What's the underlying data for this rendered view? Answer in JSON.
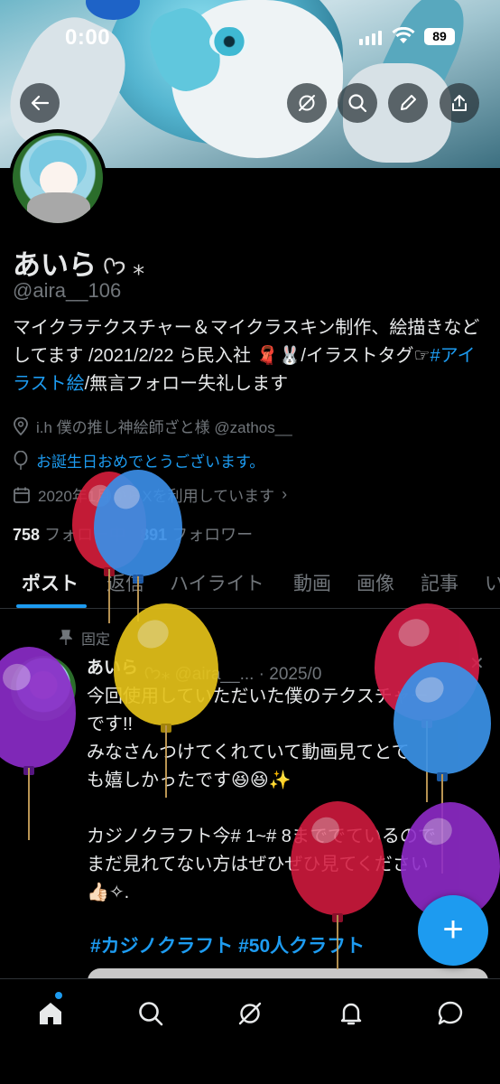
{
  "status_bar": {
    "time": "0:00",
    "battery": "89"
  },
  "profile": {
    "display_name": "あいら",
    "name_emoji": "ᢉ𐭩 ⁎",
    "handle": "@aira__106",
    "bio_part1": "マイクラテクスチャー＆マイクラスキン制作、絵描きなどしてます /2021/2/22 ら民入社 🧣🐰/イラストタグ☞",
    "bio_tag": "#アイラスト絵",
    "bio_part2": "/無言フォロー失礼します",
    "location": "i.h 僕の推し神絵師ざと様 @zathos__",
    "birthday": "お誕生日おめでとうございます。",
    "joined": "2020年1月からXを利用しています",
    "following_count": "758",
    "following_label": "フォロー中",
    "followers_count": "891",
    "followers_label": "フォロワー"
  },
  "tabs": [
    "ポスト",
    "返信",
    "ハイライト",
    "動画",
    "画像",
    "記事",
    "いいね"
  ],
  "post": {
    "pinned_label": "固定",
    "author": "あいら",
    "meta": "ᢉ𐭩⁎ @aira__... · 2025/0",
    "line1": "今回使用していただいた僕のテクスチャー",
    "line2": "です!!",
    "line3": "みなさんつけてくれていて動画見てとて",
    "line4": "も嬉しかったです😆😆✨",
    "line5": "",
    "line6": "カジノクラフト今# 1~# 8まででているので",
    "line7": "まだ見れてない方はぜひぜひ見てください",
    "line8": "👍🏻✧.",
    "tags": "#カジノクラフト #50人クラフト"
  },
  "fab_label": "+",
  "colors": {
    "accent": "#1d9bf0",
    "background": "#000000",
    "muted": "#71767b"
  },
  "icons": {
    "back": "arrow-left-icon",
    "spaces": "circle-slash-icon",
    "search": "search-icon",
    "edit": "pencil-icon",
    "share": "share-icon",
    "nav": [
      "home-icon",
      "search-icon",
      "grok-icon",
      "bell-icon",
      "message-icon"
    ]
  }
}
